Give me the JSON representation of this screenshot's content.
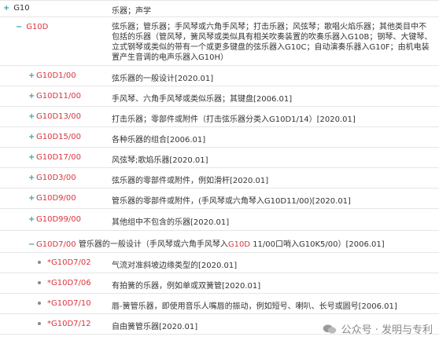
{
  "rows": [
    {
      "sign": "+",
      "sym": "G10",
      "desc": "乐器；声学"
    },
    {
      "sign": "−",
      "sym": "G10D",
      "desc": "弦乐器；管乐器；手风琴或六角手风琴；打击乐器；风弦琴；歌唱火焰乐器；其他类目中不包括的乐器（管风琴，簧风琴或类似具有相关吹奏装置的吹奏乐器入G10B；钢琴、大键琴、立式钢琴或类似的带有一个或更多键盘的弦乐器入G10C；自动演奏乐器入G10F；由机电装置产生音调的电声乐器入G10H）"
    },
    {
      "sign": "+",
      "sym": "G10D1/00",
      "desc": "弦乐器的一般设计[2020.01]"
    },
    {
      "sign": "+",
      "sym": "G10D11/00",
      "desc": "手风琴、六角手风琴或类似乐器；其键盘[2006.01]"
    },
    {
      "sign": "+",
      "sym": "G10D13/00",
      "desc": "打击乐器；零部件或附件（打击弦乐器分类入G10D1/14）[2020.01]"
    },
    {
      "sign": "+",
      "sym": "G10D15/00",
      "desc": "各种乐器的组合[2006.01]"
    },
    {
      "sign": "+",
      "sym": "G10D17/00",
      "desc": "风弦琴;歌焰乐器[2020.01]"
    },
    {
      "sign": "+",
      "sym": "G10D3/00",
      "desc": "弦乐器的零部件或附件，例如滑杆[2020.01]"
    },
    {
      "sign": "+",
      "sym": "G10D9/00",
      "desc": "管乐器的零部件或附件，(手风琴或六角琴入G10D11/00)[2020.01]"
    },
    {
      "sign": "+",
      "sym": "G10D99/00",
      "desc": "其他组中不包含的乐器[2020.01]"
    },
    {
      "sign": "−",
      "sym": "G10D7/00",
      "pre": " 管乐器的一般设计（手风琴或六角手风琴入",
      "red": "G10D",
      "post": " 11/00口哨入G10K5/00）[2006.01]"
    },
    {
      "bullet": true,
      "star": "*",
      "sym": "G10D7/02",
      "desc": "气流对准斜坡边缘类型的[2020.01]"
    },
    {
      "bullet": true,
      "star": "*",
      "sym": "G10D7/06",
      "desc": "有拍簧的乐器，例如单或双簧管[2020.01]"
    },
    {
      "bullet": true,
      "star": "*",
      "sym": "G10D7/10",
      "desc": "唇-簧管乐器，即使用音乐人嘴唇的振动，例如短号、喇叭、长号或圆号[2006.01]"
    },
    {
      "bullet": true,
      "star": "*",
      "sym": "G10D7/12",
      "desc": "自由簧管乐器[2020.01]"
    }
  ],
  "watermark": "公众号 · 发明与专利"
}
